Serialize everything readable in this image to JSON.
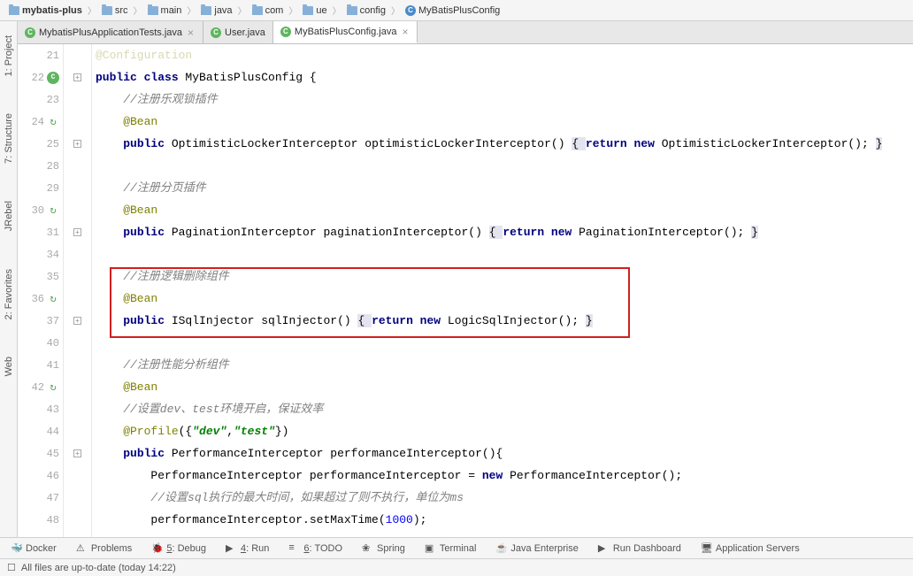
{
  "breadcrumb": [
    {
      "label": "mybatis-plus",
      "icon": "folder"
    },
    {
      "label": "src",
      "icon": "folder"
    },
    {
      "label": "main",
      "icon": "folder"
    },
    {
      "label": "java",
      "icon": "folder"
    },
    {
      "label": "com",
      "icon": "folder"
    },
    {
      "label": "ue",
      "icon": "folder"
    },
    {
      "label": "config",
      "icon": "folder"
    },
    {
      "label": "MyBatisPlusConfig",
      "icon": "class"
    }
  ],
  "left_tabs": {
    "project": "1: Project",
    "structure": "7: Structure",
    "jrebel": "JRebel",
    "favorites": "2: Favorites",
    "web": "Web"
  },
  "file_tabs": [
    {
      "label": "MybatisPlusApplicationTests.java",
      "active": false
    },
    {
      "label": "User.java",
      "active": false
    },
    {
      "label": "MyBatisPlusConfig.java",
      "active": true
    }
  ],
  "lines": [
    {
      "n": "21",
      "icon": ""
    },
    {
      "n": "22",
      "icon": "c"
    },
    {
      "n": "23",
      "icon": ""
    },
    {
      "n": "24",
      "icon": "recycle"
    },
    {
      "n": "25",
      "icon": ""
    },
    {
      "n": "28",
      "icon": ""
    },
    {
      "n": "29",
      "icon": ""
    },
    {
      "n": "30",
      "icon": "recycle"
    },
    {
      "n": "31",
      "icon": ""
    },
    {
      "n": "34",
      "icon": ""
    },
    {
      "n": "35",
      "icon": ""
    },
    {
      "n": "36",
      "icon": "recycle"
    },
    {
      "n": "37",
      "icon": ""
    },
    {
      "n": "40",
      "icon": ""
    },
    {
      "n": "41",
      "icon": ""
    },
    {
      "n": "42",
      "icon": "recycle"
    },
    {
      "n": "43",
      "icon": ""
    },
    {
      "n": "44",
      "icon": ""
    },
    {
      "n": "45",
      "icon": ""
    },
    {
      "n": "46",
      "icon": ""
    },
    {
      "n": "47",
      "icon": ""
    },
    {
      "n": "48",
      "icon": ""
    }
  ],
  "code": {
    "l0": "@Configuration",
    "l1_kw1": "public class",
    "l1_name": " MyBatisPlusConfig {",
    "l2": "    //注册乐观锁插件",
    "l3": "    @Bean",
    "l4_kw": "public",
    "l4_mid": " OptimisticLockerInterceptor optimisticLockerInterceptor() ",
    "l4_b1": "{ ",
    "l4_ret": "return new",
    "l4_end": " OptimisticLockerInterceptor(); ",
    "l4_b2": "}",
    "l6": "    //注册分页插件",
    "l7": "    @Bean",
    "l8_kw": "public",
    "l8_mid": " PaginationInterceptor paginationInterceptor() ",
    "l8_b1": "{ ",
    "l8_ret": "return new",
    "l8_end": " PaginationInterceptor(); ",
    "l8_b2": "}",
    "l10": "    //注册逻辑删除组件",
    "l11": "    @Bean",
    "l12_kw": "public",
    "l12_mid": " ISqlInjector sqlInjector() ",
    "l12_b1": "{ ",
    "l12_ret": "return new",
    "l12_end": " LogicSqlInjector(); ",
    "l12_b2": "}",
    "l14": "    //注册性能分析组件",
    "l15": "    @Bean",
    "l16_c": "    //设置dev、test环境开启，保证效率",
    "l17_a": "    @Profile",
    "l17_p1": "({",
    "l17_s1": "\"dev\"",
    "l17_c": ",",
    "l17_s2": "\"test\"",
    "l17_p2": "})",
    "l18_kw": "public",
    "l18_rest": " PerformanceInterceptor performanceInterceptor(){",
    "l19_pre": "        PerformanceInterceptor performanceInterceptor = ",
    "l19_kw": "new",
    "l19_end": " PerformanceInterceptor();",
    "l20": "        //设置sql执行的最大时间，如果超过了则不执行，单位为ms",
    "l21_pre": "        performanceInterceptor.setMaxTime(",
    "l21_num": "1000",
    "l21_end": ");"
  },
  "bottom": {
    "docker": "Docker",
    "problems": "Problems",
    "debug": "Debug",
    "debug_u": "5",
    "run": "Run",
    "run_u": "4",
    "todo": "TODO",
    "todo_u": "6",
    "spring": "Spring",
    "terminal": "Terminal",
    "javaee": "Java Enterprise",
    "rundash": "Run Dashboard",
    "appservers": "Application Servers"
  },
  "statusbar": {
    "text": "All files are up-to-date (today 14:22)"
  }
}
